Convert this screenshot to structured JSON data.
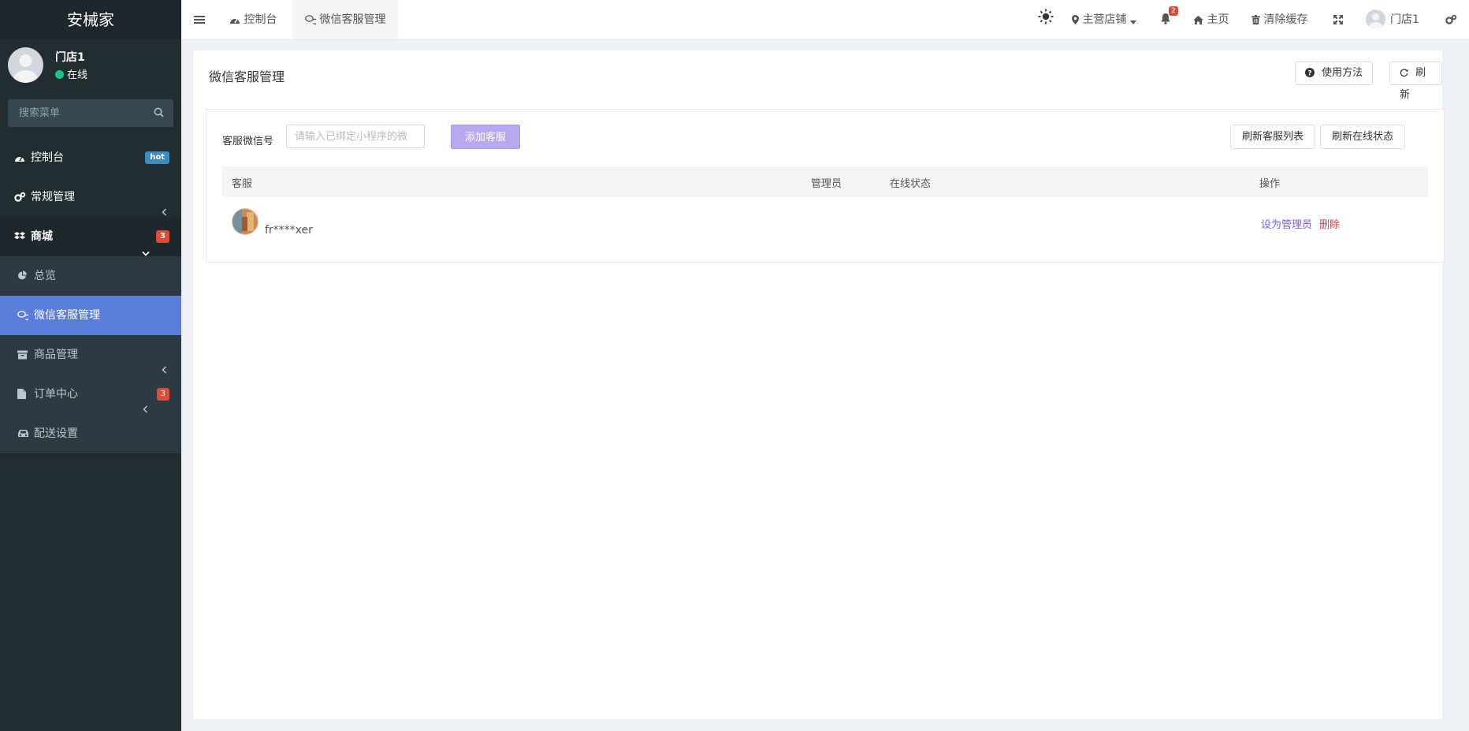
{
  "sidebar": {
    "logo": "安械家",
    "user": {
      "name": "门店1",
      "status": "在线"
    },
    "search_placeholder": "搜索菜单",
    "menu": {
      "dashboard": {
        "label": "控制台",
        "badge": "hot"
      },
      "general": {
        "label": "常规管理"
      },
      "mall": {
        "label": "商城",
        "badge": "3",
        "children": {
          "overview": {
            "label": "总览"
          },
          "wechat_cs": {
            "label": "微信客服管理"
          },
          "goods": {
            "label": "商品管理"
          },
          "orders": {
            "label": "订单中心",
            "badge": "3"
          },
          "delivery": {
            "label": "配送设置"
          }
        }
      }
    }
  },
  "topbar": {
    "tabs": [
      {
        "label": "控制台"
      },
      {
        "label": "微信客服管理"
      }
    ],
    "store_selector": "主营店铺",
    "notification_count": "2",
    "home": "主页",
    "clear_cache": "清除缓存",
    "user": "门店1"
  },
  "page": {
    "title": "微信客服管理",
    "help_button": "使用方法",
    "refresh_button": "刷新",
    "form": {
      "label": "客服微信号",
      "placeholder": "请输入已绑定小程序的微",
      "add_button": "添加客服"
    },
    "refresh_list_button": "刷新客服列表",
    "refresh_status_button": "刷新在线状态",
    "table": {
      "columns": [
        "客服",
        "管理员",
        "在线状态",
        "操作"
      ],
      "rows": [
        {
          "name": "fr****xer",
          "admin": "",
          "status": "",
          "actions": [
            "设为管理员",
            "删除"
          ]
        }
      ]
    }
  },
  "colors": {
    "sidebar_bg": "#222d32",
    "active_item": "#5a7ddc",
    "add_button": "#b7a8f0",
    "link_admin": "#7b5cf0",
    "link_delete": "#e4393c",
    "online_dot": "#1ec38b"
  }
}
